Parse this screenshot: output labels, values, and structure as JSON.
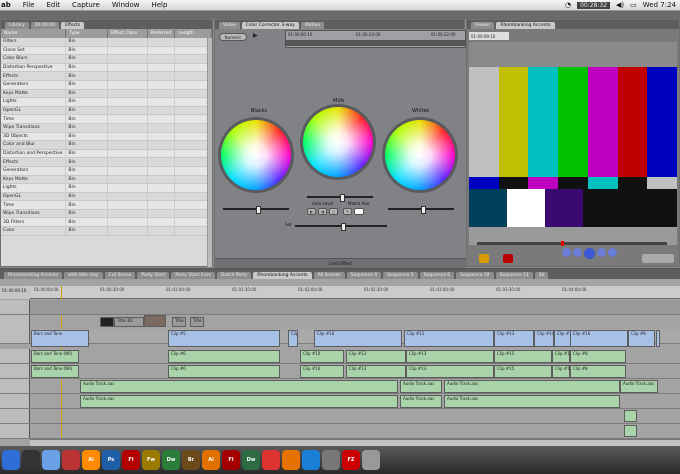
{
  "menubar": {
    "app": "ab",
    "items": [
      "File",
      "Edit",
      "Capture",
      "Window",
      "Help"
    ],
    "timer": "00:28:32",
    "clock": "Wed 7:24"
  },
  "browser": {
    "tabs": [
      "Library",
      "00:00:00",
      "Effects"
    ],
    "active_tab": "Effects",
    "columns": [
      "Name",
      "Type",
      "Effect Class",
      "Preferred",
      "Length"
    ],
    "rows": [
      {
        "name": "Filters",
        "type": "Bin"
      },
      {
        "name": "Clone Set",
        "type": "Bin"
      },
      {
        "name": "Color Blurs",
        "type": "Bin"
      },
      {
        "name": "Distortion Perspective",
        "type": "Bin"
      },
      {
        "name": "Effects",
        "type": "Bin"
      },
      {
        "name": "Generators",
        "type": "Bin"
      },
      {
        "name": "Keys Matte",
        "type": "Bin"
      },
      {
        "name": "Lights",
        "type": "Bin"
      },
      {
        "name": "OpenGL",
        "type": "Bin"
      },
      {
        "name": "Time",
        "type": "Bin"
      },
      {
        "name": "Wipe Transitions",
        "type": "Bin"
      },
      {
        "name": "3D Objects",
        "type": "Bin"
      },
      {
        "name": "Color and Blur",
        "type": "Bin"
      },
      {
        "name": "Distortion and Perspective",
        "type": "Bin"
      },
      {
        "name": "Effects",
        "type": "Bin"
      },
      {
        "name": "Generators",
        "type": "Bin"
      },
      {
        "name": "Keys Matte",
        "type": "Bin"
      },
      {
        "name": "Lights",
        "type": "Bin"
      },
      {
        "name": "OpenGL",
        "type": "Bin"
      },
      {
        "name": "Time",
        "type": "Bin"
      },
      {
        "name": "Wipe Transitions",
        "type": "Bin"
      },
      {
        "name": "3D Filters",
        "type": "Bin"
      },
      {
        "name": "Color",
        "type": "Bin"
      }
    ]
  },
  "color_corrector": {
    "tabs": [
      "Video",
      "Color Corrector 3-way",
      "Motion"
    ],
    "active_tab": "Color Corrector 3-way",
    "numeric_btn": "Numeric",
    "timecode_left": "01:00:00:16",
    "timecode_mid": "01:00:24:00",
    "timecode_right": "01:00:32:00",
    "wheels": [
      "Blacks",
      "Mids",
      "Whites"
    ],
    "auto_level": "Auto Level",
    "match_hue": "Match Hue",
    "sat_label": "Sat",
    "limit_effect": "Limit Effect"
  },
  "viewer": {
    "tabs": [
      "Viewer",
      "Rhombanking Accents"
    ],
    "active_tab": "Rhombanking Accents",
    "timecode": "01:00:09:16",
    "bar_colors": [
      "#c0c0c0",
      "#c0c000",
      "#00c0c0",
      "#00c000",
      "#c000c0",
      "#c00000",
      "#0000c0"
    ],
    "mid_colors": [
      "#0000c0",
      "#111111",
      "#c000c0",
      "#111111",
      "#00c0c0",
      "#111111",
      "#c0c0c0"
    ]
  },
  "timeline": {
    "tabs": [
      "Rhombanking Accents",
      "with title slay",
      "Cut Scene",
      "Party Start",
      "Party Start Cars",
      "Dutch Party",
      "Rhombanking Accents",
      "All Scenes",
      "Sequence 4",
      "Sequence 5",
      "Sequence 6",
      "Sequence 10",
      "Sequence 11",
      "4k"
    ],
    "active_tab": "Rhombanking Accents",
    "playhead_tc": "01:00:09:16",
    "ruler_ticks": [
      "01:00:00:00",
      "01:00:30:00",
      "01:01:00:00",
      "01:01:30:00",
      "01:02:00:00",
      "01:02:30:00",
      "01:03:00:00",
      "01:03:30:00",
      "01:04:00:00"
    ],
    "v2_clips": [
      "Title 3D",
      "Title",
      "Title"
    ],
    "v1_clips": [
      "Bars and Tone",
      "Clip #5",
      "Clip #6",
      "Clip #10",
      "Clip #11",
      "Clip #13",
      "Clip #14",
      "Clip #15",
      "Clip #16",
      "Clip #8",
      "Liquid"
    ],
    "a1_clips": [
      "Bars and Tone (NR)",
      "Clip #6",
      "Clip #10",
      "Clip #13",
      "Clip #13",
      "Clip #15",
      "Clip #16",
      "Clip #8"
    ],
    "a2_clips": [
      "Bars and Tone (NR)",
      "Clip #6",
      "Clip #10",
      "Clip #13",
      "Clip #13",
      "Clip #15",
      "Clip #16",
      "Clip #8"
    ],
    "a3_clips": [
      "Audio Track.aac",
      "Audio Track.aac",
      "Audio Track.aac",
      "Audio Track.aac"
    ],
    "a4_clips": [
      "Audio Track.aac",
      "Audio Track.aac",
      "Audio Track.aac"
    ]
  },
  "dock": {
    "icons": [
      {
        "name": "finder-icon",
        "label": "",
        "color": "#2d6fd6"
      },
      {
        "name": "dashboard-icon",
        "label": "",
        "color": "#333"
      },
      {
        "name": "mail-icon",
        "label": "",
        "color": "#6aa0e6"
      },
      {
        "name": "itunes-icon",
        "label": "",
        "color": "#b33"
      },
      {
        "name": "app-icon-ai",
        "label": "Ai",
        "color": "#ff8a00"
      },
      {
        "name": "app-icon-ps",
        "label": "Ps",
        "color": "#1f5fa8"
      },
      {
        "name": "app-icon-fl",
        "label": "Fl",
        "color": "#b30000"
      },
      {
        "name": "app-icon-fw",
        "label": "Fw",
        "color": "#9a7a00"
      },
      {
        "name": "app-icon-dw",
        "label": "Dw",
        "color": "#2b7d3a"
      },
      {
        "name": "app-icon-br",
        "label": "Br",
        "color": "#6b4a1b"
      },
      {
        "name": "app-icon-ai2",
        "label": "Ai",
        "color": "#e07000"
      },
      {
        "name": "app-icon-fl2",
        "label": "Fl",
        "color": "#a40000"
      },
      {
        "name": "app-icon-dw2",
        "label": "Dw",
        "color": "#2c6c40"
      },
      {
        "name": "chrome-icon",
        "label": "",
        "color": "#d33"
      },
      {
        "name": "firefox-icon",
        "label": "",
        "color": "#e67300"
      },
      {
        "name": "safari-icon",
        "label": "",
        "color": "#1a7fd6"
      },
      {
        "name": "system-preferences-icon",
        "label": "",
        "color": "#777"
      },
      {
        "name": "filezilla-icon",
        "label": "FZ",
        "color": "#c00"
      },
      {
        "name": "trash-icon",
        "label": "",
        "color": "#999"
      }
    ]
  }
}
